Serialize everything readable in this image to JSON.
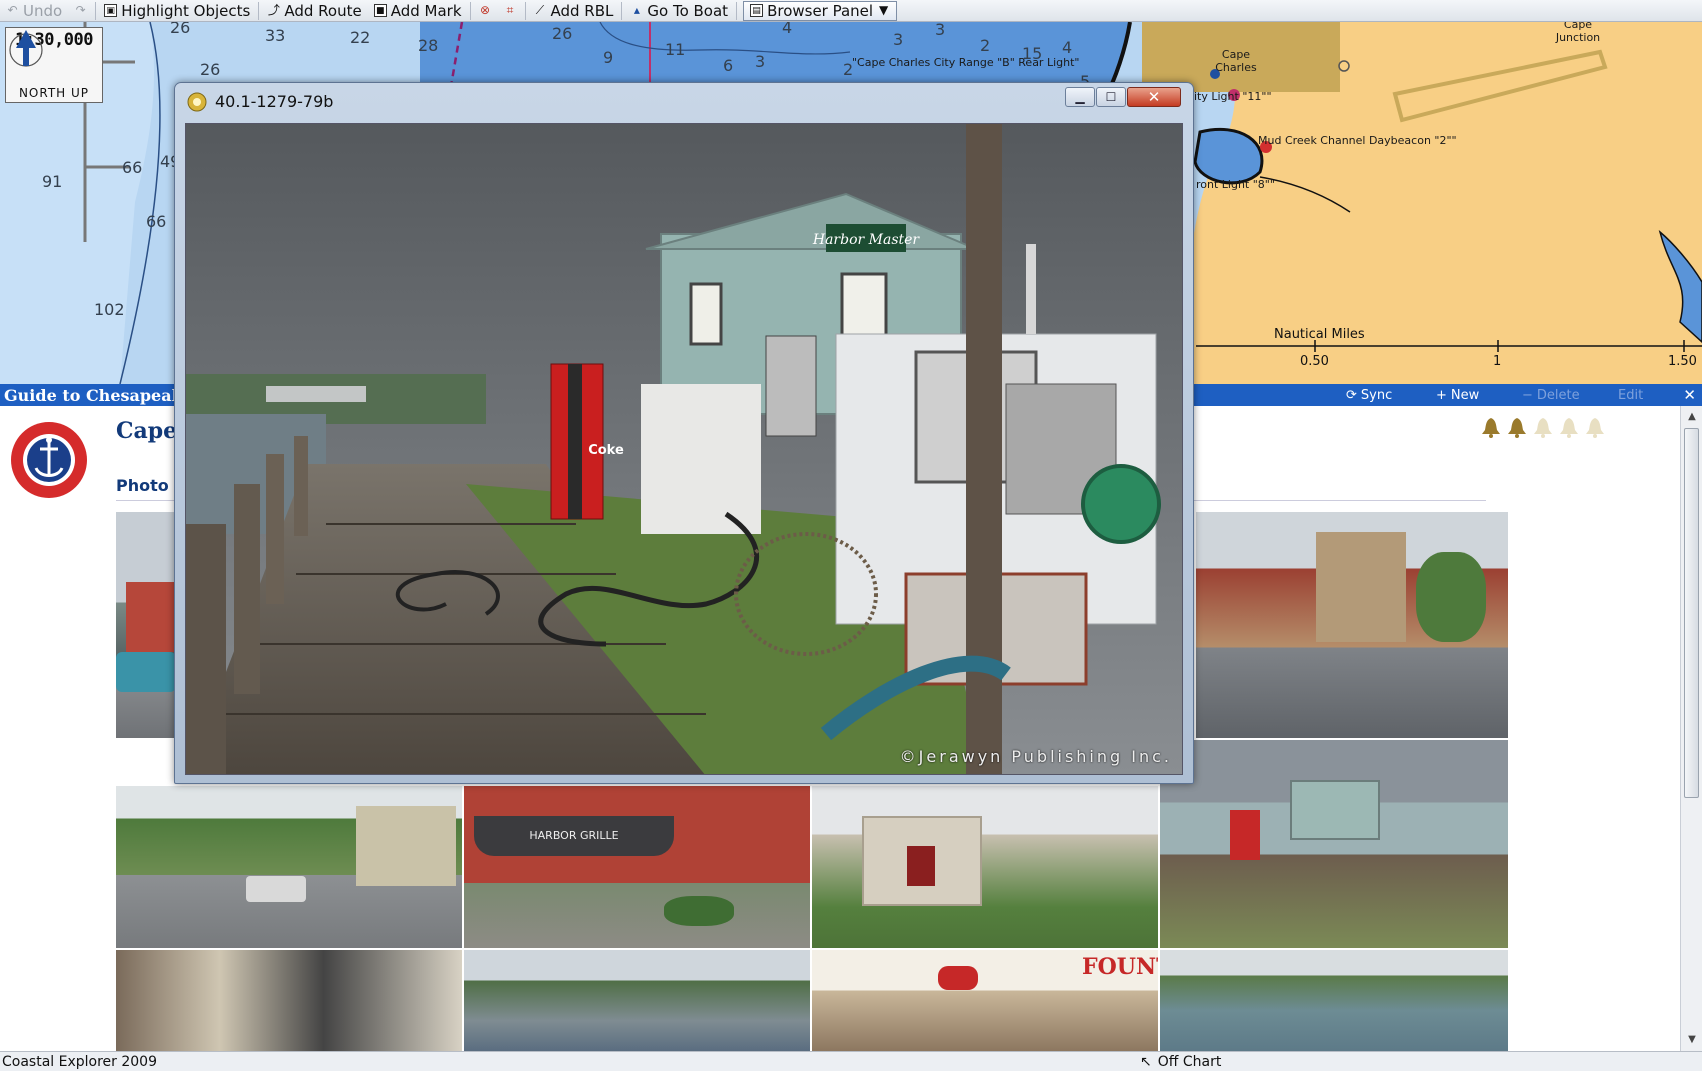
{
  "toolbar": {
    "undo": "Undo",
    "highlight": "Highlight Objects",
    "add_route": "Add Route",
    "add_mark": "Add Mark",
    "add_rbl": "Add RBL",
    "go_to_boat": "Go To Boat",
    "browser_panel": "Browser Panel"
  },
  "chart": {
    "scale": "1:30,000",
    "orientation": "NORTH UP",
    "depths": [
      "26",
      "33",
      "22",
      "28",
      "26",
      "26",
      "91",
      "66",
      "66",
      "49",
      "102",
      "9",
      "11",
      "6",
      "3",
      "4",
      "3",
      "3",
      "2",
      "15",
      "4",
      "2",
      "5"
    ],
    "labels": {
      "range_light": "\"Cape Charles City Range \"B\" Rear Light\"",
      "town": "Cape Charles",
      "junction": "Cape Junction",
      "city_light": "ity Light \"11\"\"",
      "daybeacon": "Mud Creek Channel Daybeacon \"2\"\"",
      "front_light": "ront Light \"8\"\""
    },
    "scale_units": "Nautical Miles",
    "scale_ticks": [
      "0.50",
      "1",
      "1.50"
    ]
  },
  "panel": {
    "title": "Guide to Chesapeake",
    "sync": "Sync",
    "new": "New",
    "delete": "Delete",
    "edit": "Edit",
    "close": "✕",
    "heading": "Cape",
    "subheading": "Photo G",
    "rating": {
      "filled": 2,
      "total": 5
    }
  },
  "popup": {
    "title": "40.1-1279-79b",
    "sign_text": "Harbor Master",
    "machine_text": "Coke",
    "copyright": "©Jerawyn Publishing Inc."
  },
  "photos": {
    "grille_sign": "HARBOR GRILLE",
    "fountain_sign": "FOUNTA"
  },
  "status": {
    "app": "Coastal Explorer 2009",
    "location": "Off Chart"
  },
  "colors": {
    "water_shallow": "#5a94d8",
    "water_deep": "#b8d6f2",
    "land": "#f8cf85",
    "panel_bar": "#1e5fc2",
    "brand_navy": "#123a7a"
  }
}
